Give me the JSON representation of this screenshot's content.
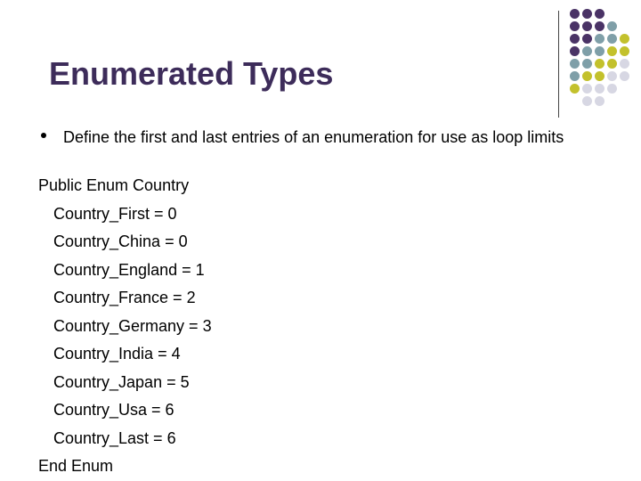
{
  "slide": {
    "title": "Enumerated Types",
    "bullet_text": "Define the first and last entries of an enumeration for use as loop limits",
    "code": {
      "open": "Public Enum Country",
      "entries": [
        "Country_First = 0",
        "Country_China = 0",
        "Country_England = 1",
        "Country_France = 2",
        "Country_Germany = 3",
        "Country_India = 4",
        "Country_Japan = 5",
        "Country_Usa = 6",
        "Country_Last = 6"
      ],
      "close": "End Enum"
    }
  },
  "decoration": {
    "dot_colors": {
      "purple": "#4a3366",
      "teal": "#7f9fa8",
      "olive": "#c3c12c",
      "light": "#d7d7e3"
    }
  }
}
